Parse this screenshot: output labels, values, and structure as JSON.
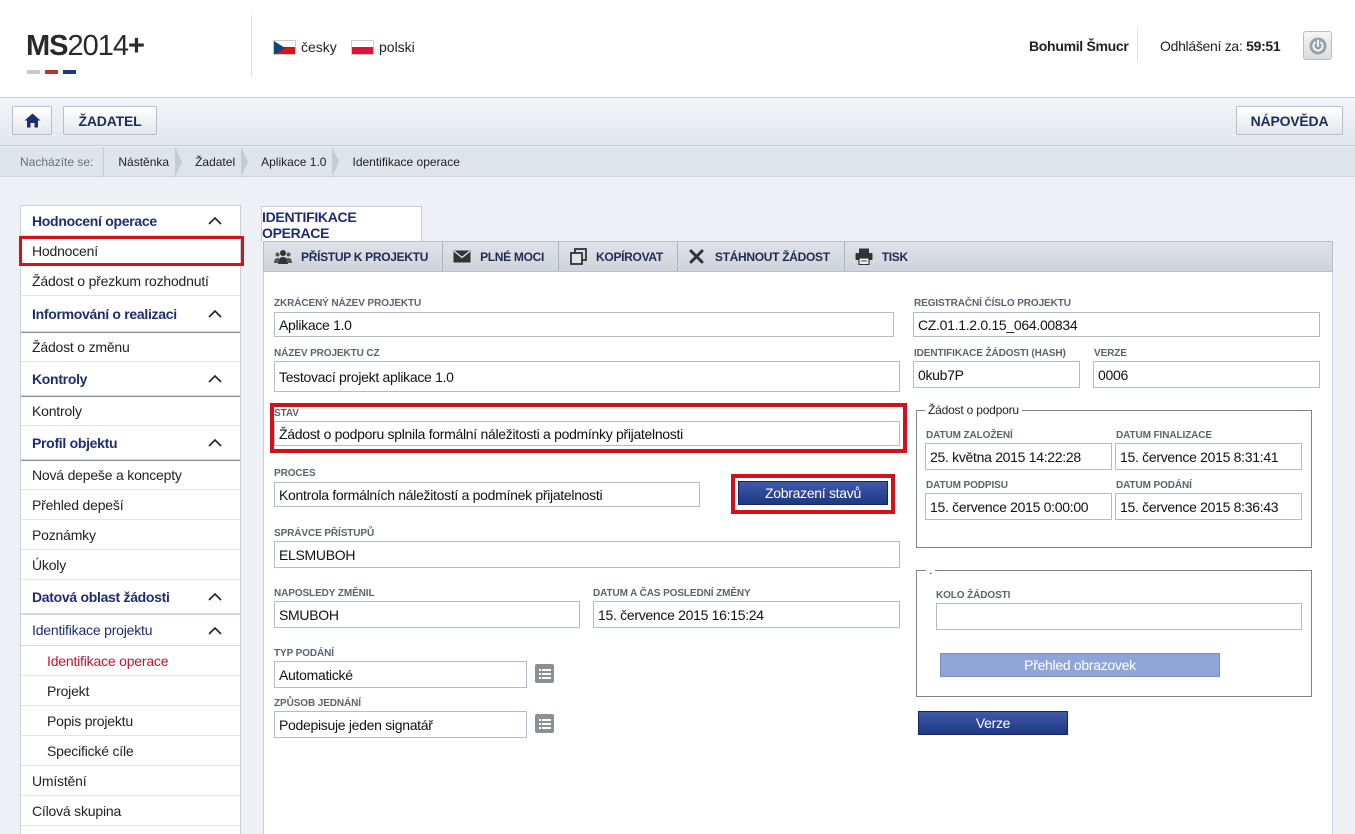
{
  "header": {
    "logo_main": "MS",
    "logo_num": "2014",
    "logo_plus": "+",
    "languages": [
      {
        "label": "česky"
      },
      {
        "label": "polski"
      }
    ],
    "user": "Bohumil Šmucr",
    "logout_label": "Odhlášení za:",
    "logout_time": "59:51"
  },
  "toolbar": {
    "zadatel_label": "ŽADATEL",
    "help_label": "NÁPOVĚDA"
  },
  "breadcrumb": {
    "label": "Nacházíte se:",
    "items": [
      "Nástěnka",
      "Žadatel",
      "Aplikace 1.0",
      "Identifikace operace"
    ]
  },
  "sidebar": {
    "hodnoceni_operace": "Hodnocení operace",
    "hodnoceni": "Hodnocení",
    "zadost_prezkum": "Žádost o přezkum rozhodnutí",
    "informovani": "Informování o realizaci",
    "zadost_zmena": "Žádost o změnu",
    "kontroly_head": "Kontroly",
    "kontroly": "Kontroly",
    "profil": "Profil objektu",
    "nova_depese": "Nová depeše a koncepty",
    "prehled_depesi": "Přehled depeší",
    "poznamky": "Poznámky",
    "ukoly": "Úkoly",
    "datova_oblast": "Datová oblast žádosti",
    "identifikace_projektu": "Identifikace projektu",
    "identifikace_operace": "Identifikace operace",
    "projekt": "Projekt",
    "popis_projektu": "Popis projektu",
    "specificke_cile": "Specifické cíle",
    "umisteni": "Umístění",
    "cilova_skupina": "Cílová skupina"
  },
  "main": {
    "tab_label": "IDENTIFIKACE OPERACE",
    "actions": {
      "pristup": "PŘÍSTUP K PROJEKTU",
      "plne_moci": "PLNÉ MOCI",
      "kopirovat": "KOPÍROVAT",
      "stahnout": "STÁHNOUT ŽÁDOST",
      "tisk": "TISK"
    },
    "fields": {
      "zkraceny_nazev_label": "ZKRÁCENÝ NÁZEV PROJEKTU",
      "zkraceny_nazev": "Aplikace 1.0",
      "nazev_cz_label": "NÁZEV PROJEKTU CZ",
      "nazev_cz": "Testovací projekt aplikace 1.0",
      "stav_label": "STAV",
      "stav": "Žádost o podporu splnila formální náležitosti a podmínky přijatelnosti",
      "proces_label": "PROCES",
      "proces": "Kontrola formálních náležitostí a podmínek přijatelnosti",
      "spravce_label": "SPRÁVCE PŘÍSTUPŮ",
      "spravce": "ELSMUBOH",
      "naposledy_label": "NAPOSLEDY ZMĚNIL",
      "naposledy": "SMUBOH",
      "datum_zmeny_label": "DATUM A ČAS POSLEDNÍ ZMĚNY",
      "datum_zmeny": "15. července 2015 16:15:24",
      "typ_podani_label": "TYP PODÁNÍ",
      "typ_podani": "Automatické",
      "zpusob_label": "ZPŮSOB JEDNÁNÍ",
      "zpusob": "Podepisuje jeden signatář",
      "reg_cislo_label": "REGISTRAČNÍ ČÍSLO PROJEKTU",
      "reg_cislo": "CZ.01.1.2.0.15_064.00834",
      "hash_label": "IDENTIFIKACE ŽÁDOSTI (HASH)",
      "hash": "0kub7P",
      "verze_label": "VERZE",
      "verze": "0006"
    },
    "zobrazeni_stavu_button": "Zobrazení stavů",
    "zadost_group": {
      "legend": "Žádost o podporu",
      "datum_zalozeni_label": "DATUM ZALOŽENÍ",
      "datum_zalozeni": "25. května 2015 14:22:28",
      "datum_finalizace_label": "DATUM FINALIZACE",
      "datum_finalizace": "15. července 2015 8:31:41",
      "datum_podpisu_label": "DATUM PODPISU",
      "datum_podpisu": "15. července 2015 0:00:00",
      "datum_podani_label": "DATUM PODÁNÍ",
      "datum_podani": "15. července 2015 8:36:43"
    },
    "kolo_group": {
      "legend": ".",
      "kolo_label": "KOLO ŽÁDOSTI",
      "kolo": "",
      "prehled_button": "Přehled obrazovek"
    },
    "verze_button": "Verze"
  },
  "colors": {
    "accent_blue": "#1d2d6f",
    "highlight_red": "#d0121f",
    "active_red": "#c4122f"
  }
}
